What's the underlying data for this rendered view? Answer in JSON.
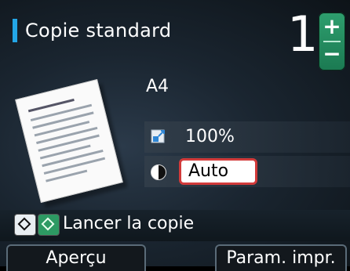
{
  "header": {
    "title": "Copie standard",
    "copies": "1",
    "plus": "+",
    "minus": "−"
  },
  "icons": {
    "stepper": "plus-minus-icon",
    "magnification": "magnification-icon",
    "density": "density-icon",
    "start_mono": "start-mono-icon",
    "start_color": "start-color-icon",
    "document": "document-icon"
  },
  "settings": {
    "paper_size": "A4",
    "magnification": "100%",
    "density": "Auto"
  },
  "start": {
    "label": "Lancer la copie"
  },
  "softkeys": {
    "left": "Aperçu",
    "right": "Param. impr."
  },
  "colors": {
    "accent": "#23a6e6",
    "highlight": "#d23a3a",
    "start_color": "#2d9a63"
  }
}
